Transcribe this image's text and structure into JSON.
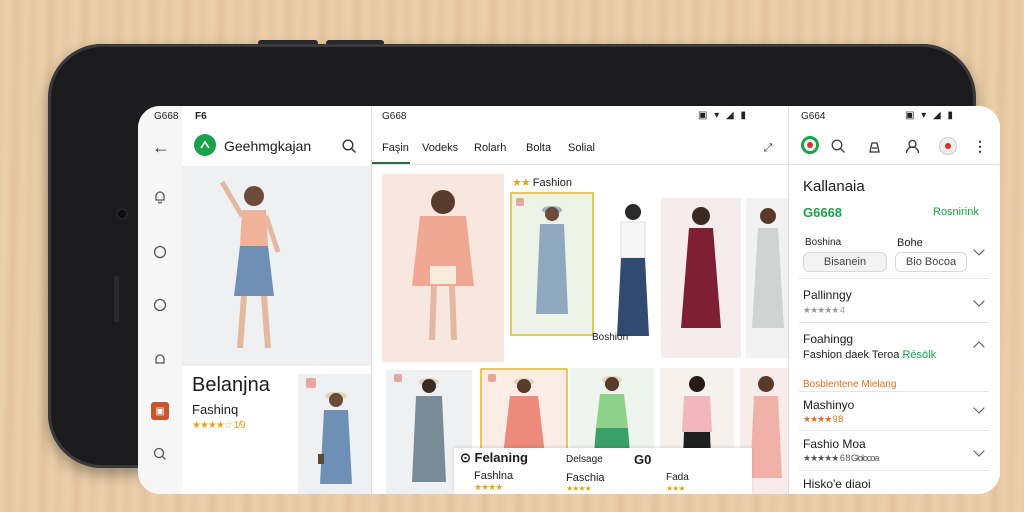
{
  "status_bar": {
    "left_time": "G668",
    "left_label": "F6",
    "mid_time": "G668",
    "right_time": "G664"
  },
  "left_panel": {
    "app_title": "Geehmgkajan",
    "promo_title": "Belanjna",
    "promo_subtitle": "Fashinq",
    "promo_rating": "★★★★☆ 1/9"
  },
  "tabs": [
    "Faşin",
    "Vodeks",
    "Rolarh",
    "Bolta",
    "Solial"
  ],
  "middle_panel": {
    "badge_text": "Fashion",
    "card_caption": "Boshion",
    "overlay_title": "Felaning",
    "overlay_left_label": "Fashlna",
    "overlay_left_stars": "★★★★",
    "overlay_mid_label": "Delsage",
    "overlay_mid_sub": "Faschia",
    "overlay_price": "G0",
    "overlay_right_label": "Fada",
    "overlay_right_stars": "★★★"
  },
  "right_panel": {
    "title": "Kallanaia",
    "price": "G6668",
    "price_tag": "Rosnirink",
    "filters": [
      {
        "label": "Boshina",
        "value": "Bisanein"
      },
      {
        "label": "Bohe",
        "value": "Bio Bocoa"
      }
    ],
    "items": [
      {
        "name": "Pallinngy",
        "meta": "★★★★★ 4",
        "expanded": false
      },
      {
        "name": "Foahingg",
        "meta": "Fashion daek Teroa",
        "meta_accent": "Résölk",
        "expanded": true
      },
      {
        "name": "Mashinyo",
        "meta": "★★★★ 9 8",
        "expanded": false
      },
      {
        "name": "Fashio Moa",
        "meta": "★★★★★ 6 8 Glolocoa",
        "expanded": false
      },
      {
        "name": "Hisko'e diaoi",
        "meta": "",
        "expanded": false
      }
    ],
    "section_label": "Bosblentene Mielang"
  },
  "colors": {
    "accent_green": "#1aa34a",
    "accent_orange": "#e0701c",
    "star_yellow": "#e4a51c"
  }
}
